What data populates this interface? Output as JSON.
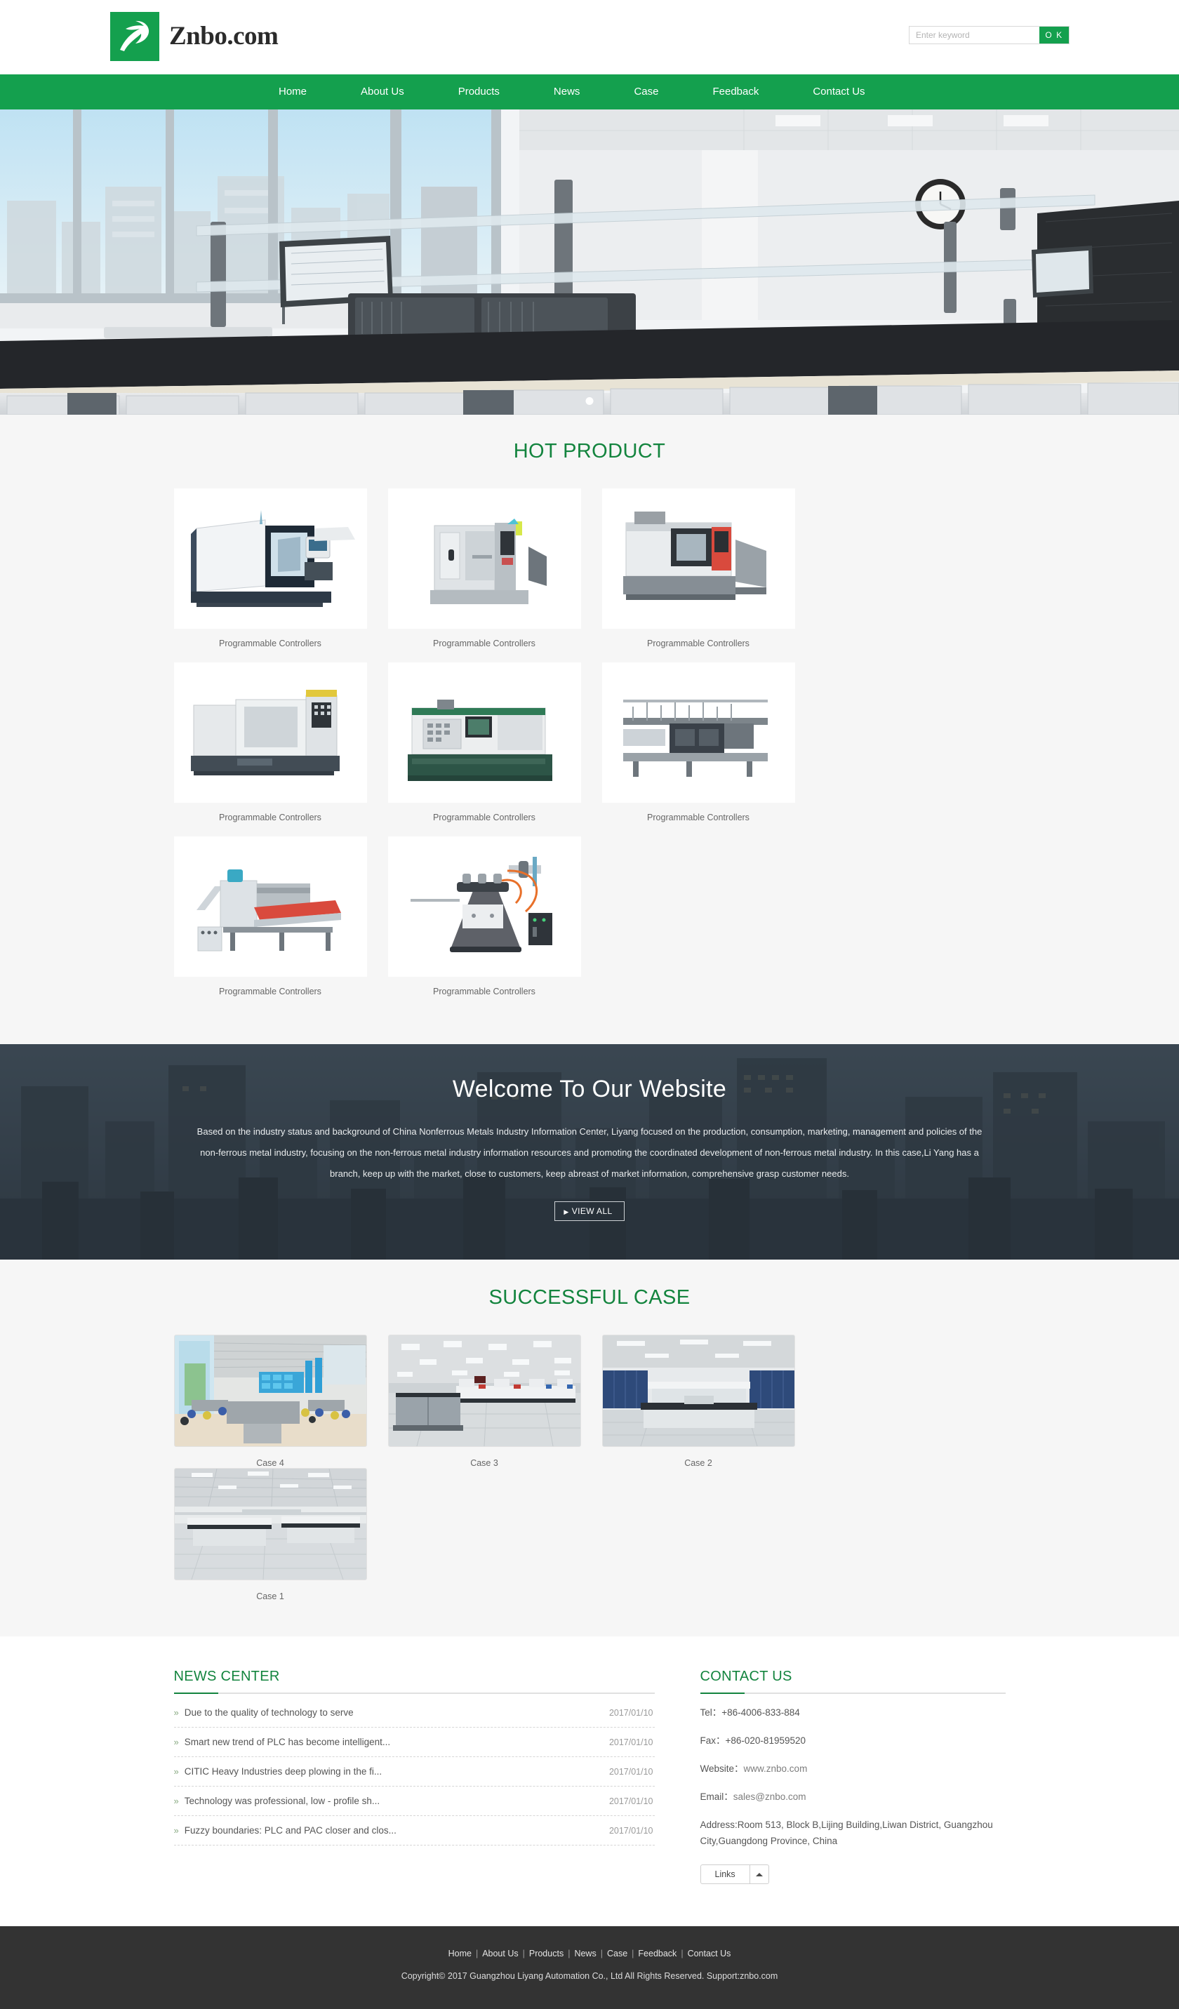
{
  "header": {
    "logo_text": "Znbo.com",
    "logo_icon": "bird-swoosh-logo",
    "search_placeholder": "Enter keyword",
    "search_value": "",
    "search_button": "O K"
  },
  "nav": {
    "items": [
      {
        "label": "Home"
      },
      {
        "label": "About Us"
      },
      {
        "label": "Products"
      },
      {
        "label": "News"
      },
      {
        "label": "Case"
      },
      {
        "label": "Feedback"
      },
      {
        "label": "Contact Us"
      }
    ]
  },
  "hero": {
    "alt": "laboratory interior with workbenches and equipment",
    "slide_count": 1,
    "active_slide": 1
  },
  "hot_products": {
    "title": "HOT PRODUCT",
    "items": [
      {
        "caption": "Programmable Controllers",
        "image": "cnc-lathe-machine"
      },
      {
        "caption": "Programmable Controllers",
        "image": "cnc-milling-center"
      },
      {
        "caption": "Programmable Controllers",
        "image": "cnc-turning-lathe"
      },
      {
        "caption": "Programmable Controllers",
        "image": "cnc-slant-bed-lathe"
      },
      {
        "caption": "Programmable Controllers",
        "image": "cnc-benchtop-lathe"
      },
      {
        "caption": "Programmable Controllers",
        "image": "glass-edging-machine"
      },
      {
        "caption": "Programmable Controllers",
        "image": "glass-washing-machine"
      },
      {
        "caption": "Programmable Controllers",
        "image": "glass-drilling-machine"
      }
    ]
  },
  "welcome": {
    "title": "Welcome To Our Website",
    "paragraph": "Based on the industry status and background of China Nonferrous Metals Industry Information Center, Liyang focused on the production, consumption, marketing, management and policies of the non-ferrous metal industry, focusing on the non-ferrous metal industry information resources and promoting the coordinated development of non-ferrous metal industry. In this case,Li Yang has a branch, keep up with the market, close to customers, keep abreast of market information, comprehensive grasp customer needs.",
    "view_all_label": "VIEW ALL"
  },
  "cases": {
    "title": "SUCCESSFUL CASE",
    "items": [
      {
        "caption": "Case 4",
        "image": "lab-classroom-interior"
      },
      {
        "caption": "Case 3",
        "image": "lab-white-benches"
      },
      {
        "caption": "Case 2",
        "image": "lab-blue-cabinets"
      },
      {
        "caption": "Case 1",
        "image": "lab-large-hall"
      }
    ]
  },
  "news": {
    "title": "NEWS CENTER",
    "bullet": "»",
    "items": [
      {
        "title": "Due to the quality of technology to serve",
        "date": "2017/01/10"
      },
      {
        "title": "Smart new trend of PLC has become intelligent...",
        "date": "2017/01/10"
      },
      {
        "title": "CITIC Heavy Industries deep plowing in the fi...",
        "date": "2017/01/10"
      },
      {
        "title": "Technology was professional, low - profile sh...",
        "date": "2017/01/10"
      },
      {
        "title": "Fuzzy boundaries: PLC and PAC closer and clos...",
        "date": "2017/01/10"
      }
    ]
  },
  "contact": {
    "title": "CONTACT US",
    "tel_label": "Tel：",
    "tel_value": "+86-4006-833-884",
    "fax_label": "Fax：",
    "fax_value": "+86-020-81959520",
    "website_label": "Website：",
    "website_value": "www.znbo.com",
    "email_label": "Email：",
    "email_value": "sales@znbo.com",
    "address": "Address:Room 513, Block B,Lijing Building,Liwan District, Guangzhou City,Guangdong Province, China",
    "links_label": "Links"
  },
  "footer": {
    "nav": [
      "Home",
      "About Us",
      "Products",
      "News",
      "Case",
      "Feedback",
      "Contact Us"
    ],
    "separator": "|",
    "copyright": "Copyright© 2017 Guangzhou Liyang Automation Co., Ltd All Rights Reserved.  Support:znbo.com"
  },
  "colors": {
    "brand_green": "#14a04e",
    "heading_green": "#13843e",
    "footer_dark": "#333333",
    "section_grey": "#f6f6f6"
  }
}
